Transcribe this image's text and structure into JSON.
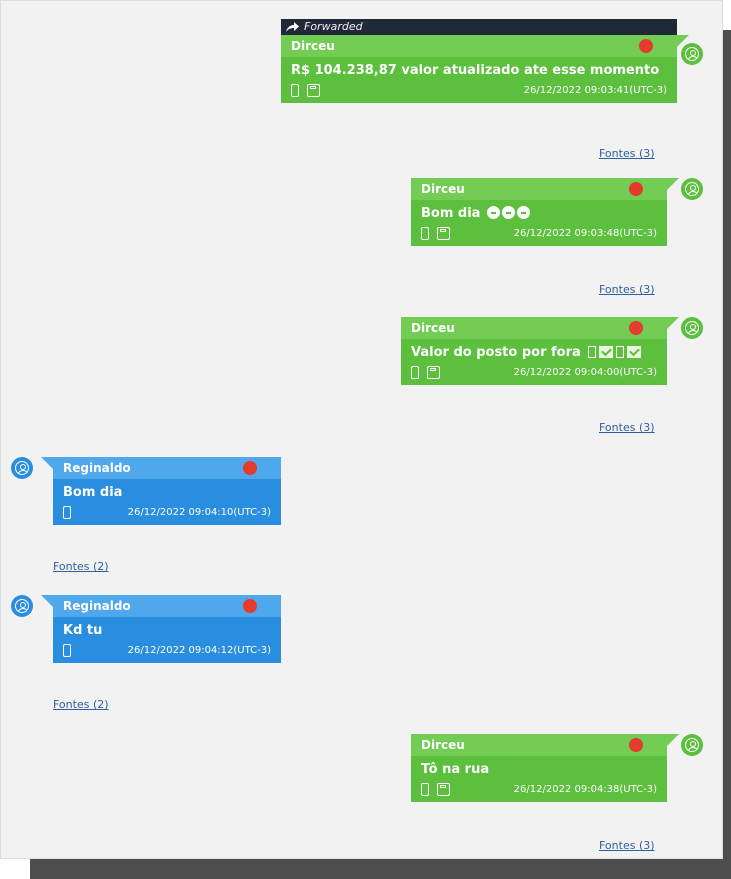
{
  "messages": [
    {
      "sender": "Dirceu",
      "forwarded": "Forwarded",
      "text": "R$ 104.238,87 valor atualizado ate esse momento",
      "timestamp": "26/12/2022 09:03:41(UTC-3)",
      "sources": "Fontes (3)"
    },
    {
      "sender": "Dirceu",
      "text": "Bom dia",
      "timestamp": "26/12/2022 09:03:48(UTC-3)",
      "sources": "Fontes (3)"
    },
    {
      "sender": "Dirceu",
      "text": "Valor do posto por fora",
      "timestamp": "26/12/2022 09:04:00(UTC-3)",
      "sources": "Fontes (3)"
    },
    {
      "sender": "Reginaldo",
      "text": "Bom dia",
      "timestamp": "26/12/2022 09:04:10(UTC-3)",
      "sources": "Fontes (2)"
    },
    {
      "sender": "Reginaldo",
      "text": "Kd tu",
      "timestamp": "26/12/2022 09:04:12(UTC-3)",
      "sources": "Fontes (2)"
    },
    {
      "sender": "Dirceu",
      "text": "Tô na rua",
      "timestamp": "26/12/2022 09:04:38(UTC-3)",
      "sources": "Fontes (3)"
    }
  ],
  "icons": {
    "forward": "forward-arrow-icon",
    "avatar": "user-avatar-icon",
    "status": "status-dot-icon",
    "device": "phone-icon",
    "storage": "disk-icon",
    "emoji": "emoji-icon"
  },
  "colors": {
    "outgoing": "#5cbf3d",
    "incoming": "#2a8ee0",
    "status_dot": "#e53b2c",
    "forwarded_bar": "#1f2937",
    "link": "#2f5f9f"
  }
}
